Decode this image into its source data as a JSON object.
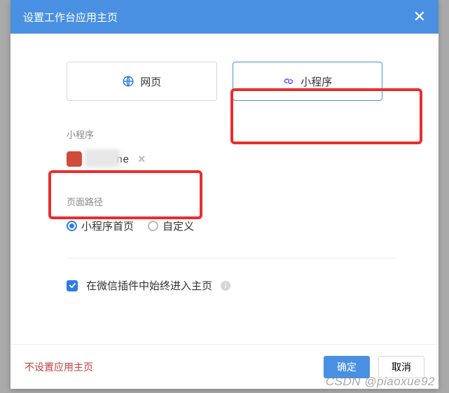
{
  "modal": {
    "title": "设置工作台应用主页",
    "tabs": {
      "web": "网页",
      "miniapp": "小程序"
    },
    "miniapp": {
      "section_label": "小程序",
      "app_name_obscured": "        ne"
    },
    "page_path": {
      "section_label": "页面路径",
      "options": {
        "home": "小程序首页",
        "custom": "自定义"
      }
    },
    "plugin": {
      "label": "在微信插件中始终进入主页"
    },
    "footer": {
      "no_home": "不设置应用主页",
      "ok": "确定",
      "cancel": "取消"
    }
  },
  "watermark": "CSDN @piaoxue92"
}
